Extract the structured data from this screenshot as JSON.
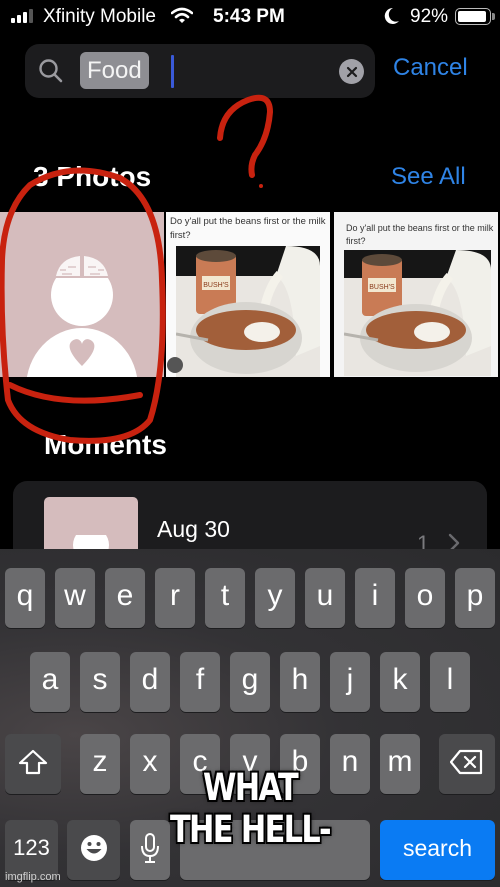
{
  "status_bar": {
    "carrier": "Xfinity Mobile",
    "time": "5:43 PM",
    "battery_percent": "92%",
    "battery_level": 0.92,
    "signal_bars_active": 3,
    "signal_bars_total": 4,
    "icons": [
      "signal-icon",
      "wifi-icon",
      "moon-icon",
      "battery-icon"
    ]
  },
  "search": {
    "query": "Food",
    "clear_icon": "clear-icon",
    "search_icon": "search-icon",
    "cancel_label": "Cancel"
  },
  "photos_section": {
    "title": "3 Photos",
    "see_all_label": "See All",
    "photos": [
      {
        "kind": "avatar-placeholder",
        "description": "person silhouette with brain and heart"
      },
      {
        "kind": "meme",
        "caption": "Do y'all put the beans first or the milk first?",
        "can_label": "BUSH'S"
      },
      {
        "kind": "meme",
        "caption": "Do y'all put the beans first or the milk first?",
        "can_label": "BUSH'S"
      }
    ]
  },
  "moments_section": {
    "title": "Moments",
    "items": [
      {
        "date": "Aug 30",
        "count": "1"
      }
    ]
  },
  "keyboard": {
    "row1": [
      "q",
      "w",
      "e",
      "r",
      "t",
      "y",
      "u",
      "i",
      "o",
      "p"
    ],
    "row2": [
      "a",
      "s",
      "d",
      "f",
      "g",
      "h",
      "j",
      "k",
      "l"
    ],
    "row3": [
      "z",
      "x",
      "c",
      "v",
      "b",
      "n",
      "m"
    ],
    "shift_icon": "shift-icon",
    "delete_icon": "delete-icon",
    "numbers_label": "123",
    "emoji_icon": "emoji-icon",
    "mic_icon": "microphone-icon",
    "action_label": "search",
    "colors": {
      "action": "#0a7bf3"
    }
  },
  "overlay": {
    "meme_text_line1": "WHAT",
    "meme_text_line2": "THE HELL-",
    "watermark": "imgflip.com",
    "annotation_color": "#c8220f"
  },
  "colors": {
    "accent": "#2f84e6",
    "background": "#000000"
  }
}
